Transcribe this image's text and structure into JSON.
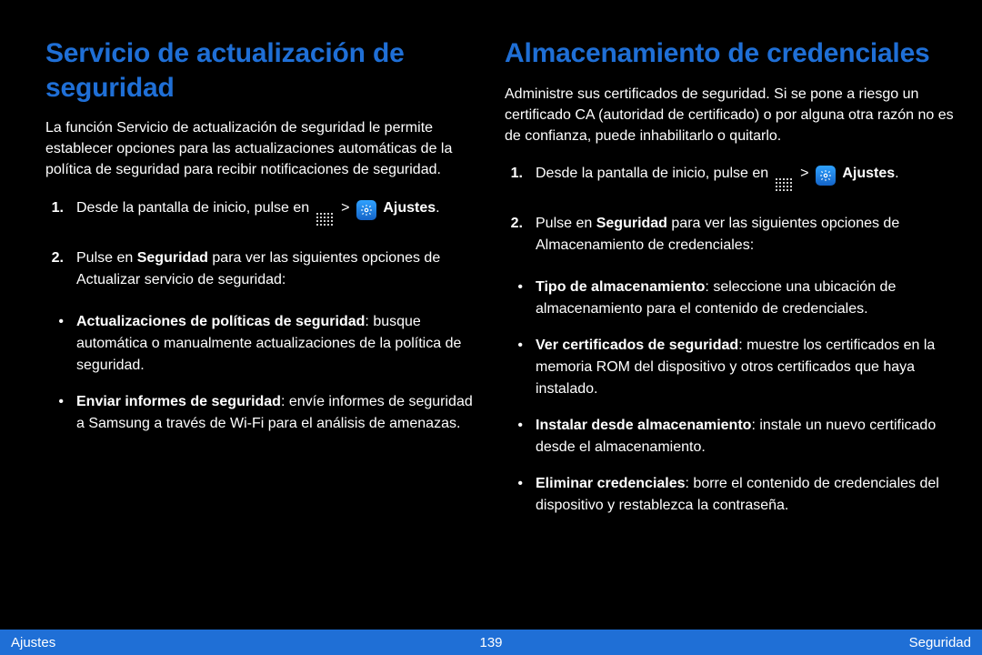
{
  "left": {
    "title": "Servicio de actualización de seguridad",
    "intro": "La función Servicio de actualización de seguridad le permite establecer opciones para las actualizaciones automáticas de la política de seguridad para recibir notificaciones de seguridad.",
    "steps": [
      {
        "num": "1.",
        "prefix": "Desde la pantalla de inicio, pulse en ",
        "after_apps": " > ",
        "after_settings": " ",
        "bold": "Ajustes",
        "suffix": "."
      },
      {
        "num": "2.",
        "prefix": "Pulse en ",
        "bold": "Seguridad",
        "suffix": " para ver las siguientes opciones de Actualizar servicio de seguridad:"
      }
    ],
    "bullets": [
      {
        "label": "Actualizaciones de políticas de seguridad",
        "desc": ": busque automática o manualmente actualizaciones de la política de seguridad."
      },
      {
        "label": "Enviar informes de seguridad",
        "desc": ": envíe informes de seguridad a Samsung a través de Wi-Fi para el análisis de amenazas."
      }
    ]
  },
  "right": {
    "title": "Almacenamiento de credenciales",
    "intro": "Administre sus certificados de seguridad. Si se pone a riesgo un certificado CA (autoridad de certificado) o por alguna otra razón no es de confianza, puede inhabilitarlo o quitarlo.",
    "steps": [
      {
        "num": "1.",
        "prefix": "Desde la pantalla de inicio, pulse en ",
        "after_apps": " > ",
        "after_settings": " ",
        "bold": "Ajustes",
        "suffix": "."
      },
      {
        "num": "2.",
        "prefix": "Pulse en ",
        "bold": "Seguridad",
        "suffix": " para ver las siguientes opciones de Almacenamiento de credenciales:"
      }
    ],
    "bullets": [
      {
        "label": "Tipo de almacenamiento",
        "desc": ": seleccione una ubicación de almacenamiento para el contenido de credenciales."
      },
      {
        "label": "Ver certificados de seguridad",
        "desc": ": muestre los certificados en la memoria ROM del dispositivo y otros certificados que haya instalado."
      },
      {
        "label": "Instalar desde almacenamiento",
        "desc": ": instale un nuevo certificado desde el almacenamiento."
      },
      {
        "label": "Eliminar credenciales",
        "desc": ": borre el contenido de credenciales del dispositivo y restablezca la contraseña."
      }
    ]
  },
  "footer": {
    "left": "Ajustes",
    "center": "139",
    "right": "Seguridad"
  },
  "glyphs": {
    "bullet": "•"
  }
}
